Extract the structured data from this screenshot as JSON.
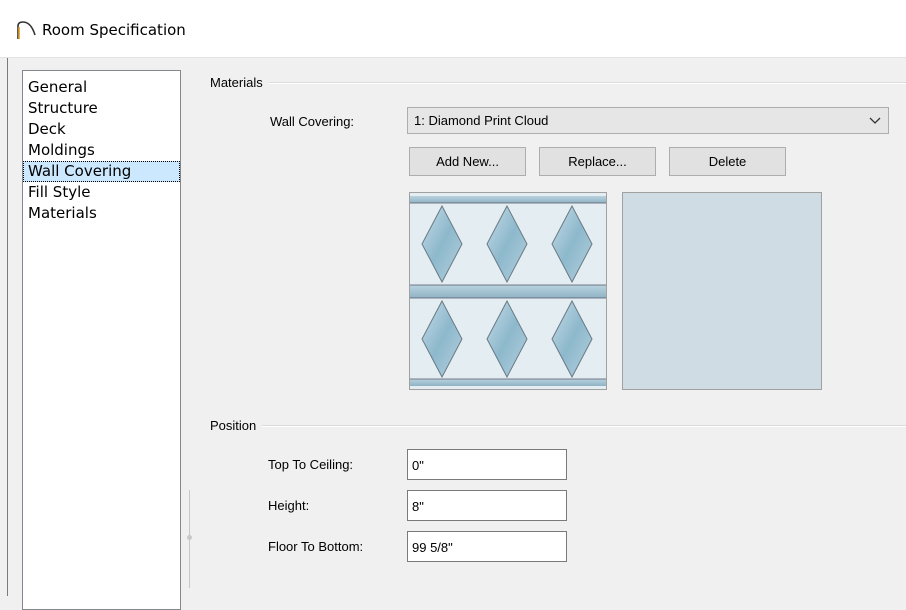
{
  "window": {
    "title": "Room Specification"
  },
  "sidebar": {
    "items": [
      {
        "label": "General",
        "selected": false
      },
      {
        "label": "Structure",
        "selected": false
      },
      {
        "label": "Deck",
        "selected": false
      },
      {
        "label": "Moldings",
        "selected": false
      },
      {
        "label": "Wall Covering",
        "selected": true
      },
      {
        "label": "Fill Style",
        "selected": false
      },
      {
        "label": "Materials",
        "selected": false
      }
    ]
  },
  "materials": {
    "group_label": "Materials",
    "wall_covering_label": "Wall Covering:",
    "wall_covering_value": "1:  Diamond Print Cloud",
    "add_new_label": "Add New...",
    "replace_label": "Replace...",
    "delete_label": "Delete",
    "color_swatch": "#cfdce4"
  },
  "position": {
    "group_label": "Position",
    "top_to_ceiling_label": "Top To Ceiling:",
    "top_to_ceiling_value": "0\"",
    "height_label": "Height:",
    "height_value": "8\"",
    "floor_to_bottom_label": "Floor To Bottom:",
    "floor_to_bottom_value": "99 5/8\""
  }
}
